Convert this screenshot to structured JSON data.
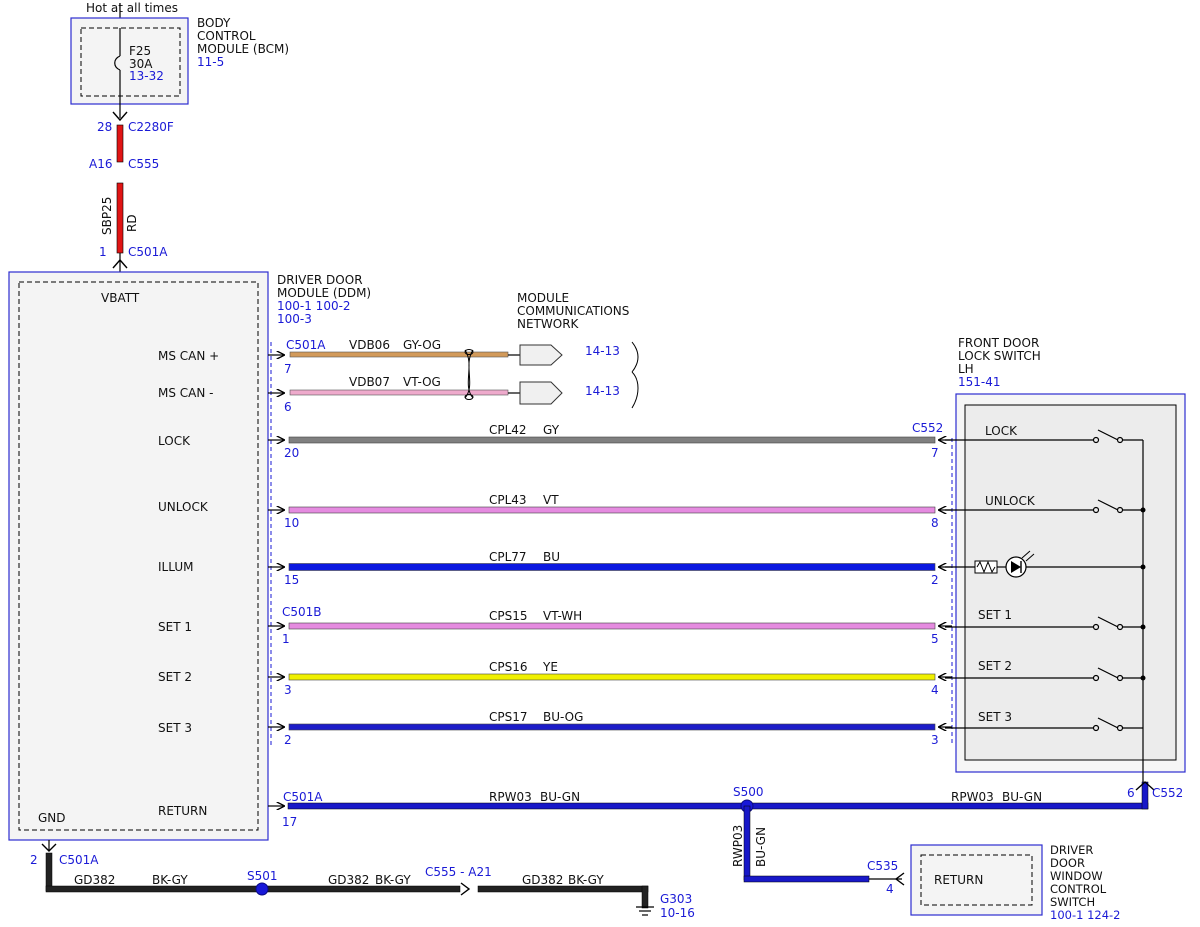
{
  "top": {
    "hot_label": "Hot at all times"
  },
  "bcm": {
    "name_lines": [
      "BODY",
      "CONTROL",
      "MODULE (BCM)"
    ],
    "ref": "11-5",
    "fuse": {
      "id": "F25",
      "rating": "30A",
      "ref": "13-32"
    }
  },
  "feed": {
    "c2280f_pin": "28",
    "c2280f": "C2280F",
    "c555_pin": "A16",
    "c555": "C555",
    "circuit": "SBP25",
    "color": "RD",
    "c501a_pin": "1",
    "c501a": "C501A"
  },
  "ddm": {
    "name_lines": [
      "DRIVER DOOR",
      "MODULE (DDM)"
    ],
    "refs": [
      "100-1  100-2",
      "100-3"
    ],
    "vbatt": "VBATT",
    "gnd": "GND",
    "pins": [
      "MS CAN +",
      "MS CAN -",
      "LOCK",
      "UNLOCK",
      "ILLUM",
      "SET 1",
      "SET 2",
      "SET 3",
      "RETURN"
    ]
  },
  "network": {
    "label_lines": [
      "MODULE",
      "COMMUNICATIONS",
      "NETWORK"
    ],
    "connector": "C501A",
    "wires": [
      {
        "pin": "7",
        "circuit": "VDB06",
        "color": "GY-OG",
        "ref": "14-13"
      },
      {
        "pin": "6",
        "circuit": "VDB07",
        "color": "VT-OG",
        "ref": "14-13"
      }
    ]
  },
  "switch": {
    "name_lines": [
      "FRONT DOOR",
      "LOCK SWITCH",
      "LH"
    ],
    "ref": "151-41",
    "connector": "C552",
    "contacts": [
      "LOCK",
      "UNLOCK",
      "SET 1",
      "SET 2",
      "SET 3"
    ]
  },
  "wires": [
    {
      "ddm_pin": "20",
      "circuit": "CPL42",
      "color": "GY",
      "sw_pin": "7",
      "fill": "#808080"
    },
    {
      "ddm_pin": "10",
      "circuit": "CPL43",
      "color": "VT",
      "sw_pin": "8",
      "fill": "#e58be0"
    },
    {
      "ddm_pin": "15",
      "circuit": "CPL77",
      "color": "BU",
      "sw_pin": "2",
      "fill": "#0b18e0"
    },
    {
      "ddm_pin": "1",
      "circuit": "CPS15",
      "color": "VT-WH",
      "sw_pin": "5",
      "fill": "#e58be0",
      "connector": "C501B"
    },
    {
      "ddm_pin": "3",
      "circuit": "CPS16",
      "color": "YE",
      "sw_pin": "4",
      "fill": "#f0f000"
    },
    {
      "ddm_pin": "2",
      "circuit": "CPS17",
      "color": "BU-OG",
      "sw_pin": "3",
      "fill": "#1c1cc8"
    }
  ],
  "return_wire": {
    "connector": "C501A",
    "ddm_pin": "17",
    "circuit": "RPW03",
    "color": "BU-GN",
    "splice": "S500",
    "sw_pin": "6",
    "sw_connector": "C552",
    "branch_circuit": "RWP03",
    "branch_color": "BU-GN"
  },
  "window_switch": {
    "connector": "C535",
    "pin": "4",
    "contact": "RETURN",
    "name_lines": [
      "DRIVER",
      "DOOR",
      "WINDOW",
      "CONTROL",
      "SWITCH"
    ],
    "refs": "100-1  124-2"
  },
  "ground": {
    "pin": "2",
    "connector": "C501A",
    "circuit": "GD382",
    "color": "BK-GY",
    "splice": "S501",
    "inline_connector": "C555  -  A21",
    "ground_id": "G303",
    "ref": "10-16"
  }
}
